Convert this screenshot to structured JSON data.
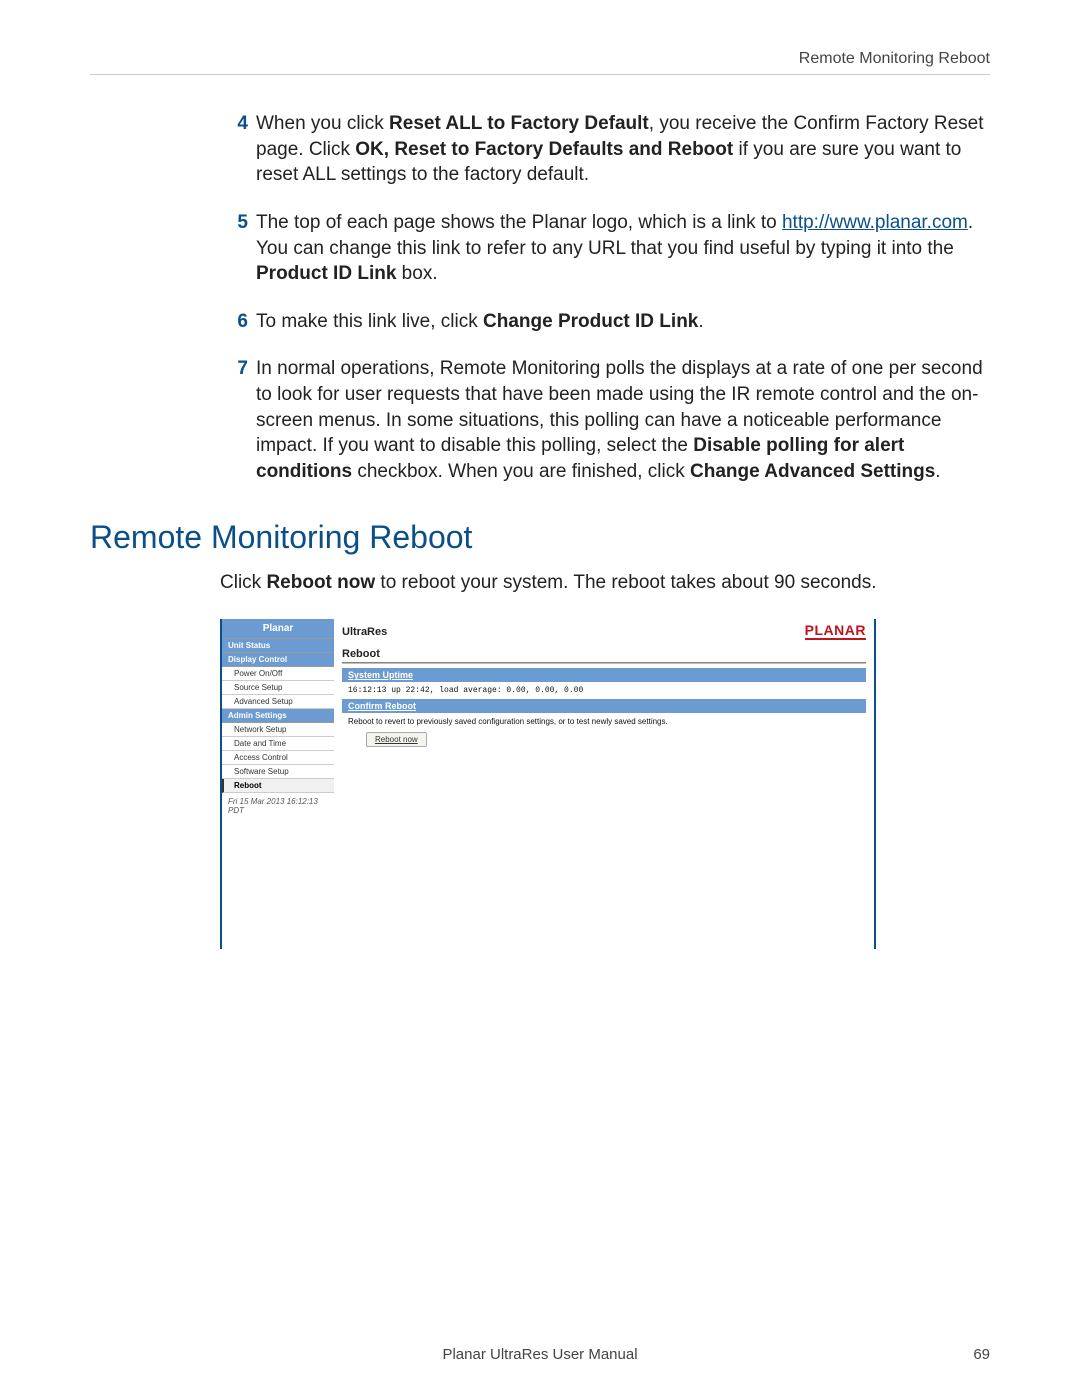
{
  "header": {
    "right": "Remote Monitoring Reboot"
  },
  "steps": {
    "s4": {
      "num": "4",
      "t1": "When you click ",
      "b1": "Reset ALL to Factory Default",
      "t2": ", you receive the Confirm Factory Reset page. Click ",
      "b2": "OK, Reset to Factory Defaults and Reboot",
      "t3": " if you are sure you want to reset ALL settings to the factory default."
    },
    "s5": {
      "num": "5",
      "t1": "The top of each page shows the Planar logo, which is a link to ",
      "link": "http://www.planar.com",
      "t2": ". You can change this link to refer to any URL that you find useful by typing it into the ",
      "b1": "Product ID Link",
      "t3": " box."
    },
    "s6": {
      "num": "6",
      "t1": "To make this link live, click ",
      "b1": "Change Product ID Link",
      "t2": "."
    },
    "s7": {
      "num": "7",
      "t1": "In normal operations, Remote Monitoring polls the displays at a rate of one per second to look for user requests that have been made using the IR remote control and the on-screen menus. In some situations, this polling can have a noticeable performance impact. If you want to disable this polling, select the ",
      "b1": "Disable polling for alert conditions",
      "t2": " checkbox. When you are finished, click ",
      "b2": "Change Advanced Settings",
      "t3": "."
    }
  },
  "section_title": "Remote Monitoring Reboot",
  "intro": {
    "t1": "Click ",
    "b1": "Reboot now",
    "t2": " to reboot your system. The reboot takes about 90 seconds."
  },
  "screenshot": {
    "sidebar": {
      "brand": "Planar",
      "groups": [
        {
          "head": "Unit Status",
          "items": []
        },
        {
          "head": "Display Control",
          "items": [
            "Power On/Off",
            "Source Setup",
            "Advanced Setup"
          ]
        },
        {
          "head": "Admin Settings",
          "items": [
            "Network Setup",
            "Date and Time",
            "Access Control",
            "Software Setup"
          ],
          "selected": "Reboot"
        }
      ],
      "timestamp": "Fri 15 Mar 2013 16:12:13 PDT"
    },
    "main": {
      "product": "UltraRes",
      "logo": "PLANAR",
      "panel": "Reboot",
      "uptime_label": "System Uptime",
      "uptime_value": "16:12:13 up 22:42, load average: 0.00, 0.00, 0.00",
      "confirm_label": "Confirm Reboot",
      "confirm_text": "Reboot to revert to previously saved configuration settings, or to test newly saved settings.",
      "button": "Reboot now"
    }
  },
  "footer": {
    "title": "Planar UltraRes User Manual",
    "page": "69"
  }
}
